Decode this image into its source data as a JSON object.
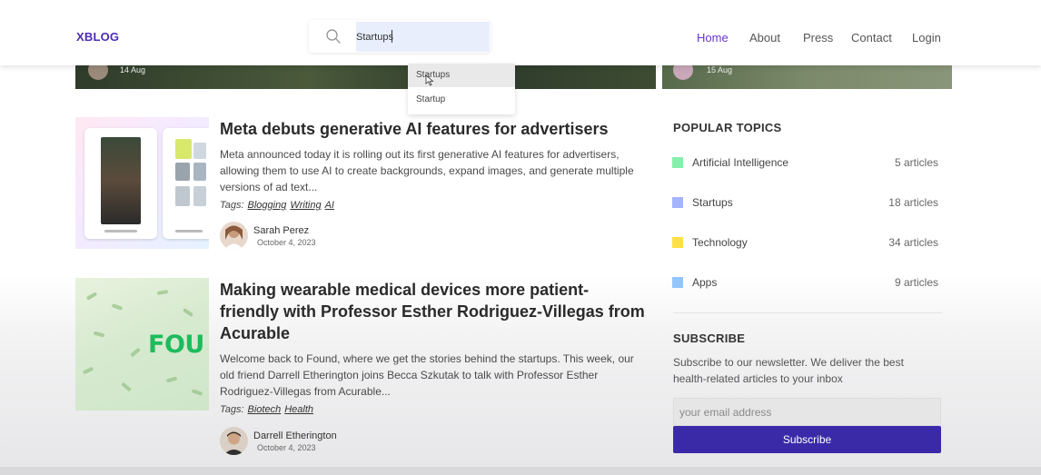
{
  "header": {
    "logo": "XBLOG",
    "search": {
      "value": "Startups",
      "placeholder": ""
    },
    "nav": [
      {
        "label": "Home",
        "active": true
      },
      {
        "label": "About"
      },
      {
        "label": "Press"
      },
      {
        "label": "Contact"
      },
      {
        "label": "Login"
      }
    ]
  },
  "autocomplete": [
    "Startups",
    "Startup"
  ],
  "hero_strips": [
    {
      "date": "14 Aug"
    },
    {
      "date": "15 Aug"
    }
  ],
  "articles": [
    {
      "title": "Meta debuts generative AI features for advertisers",
      "excerpt": "Meta announced today it is rolling out its first generative AI features for advertisers, allowing them to use AI to create backgrounds, expand images, and generate multiple versions of ad text...",
      "tags_label": "Tags:",
      "tags": [
        "Blogging",
        "Writing",
        "AI"
      ],
      "author": "Sarah Perez",
      "date": "October 4, 2023"
    },
    {
      "title": "Making wearable medical devices more patient-friendly with Professor Esther Rodriguez-Villegas from Acurable",
      "thumb_text": "FOU",
      "excerpt": "Welcome back to Found, where we get the stories behind the startups. This week, our old friend Darrell Etherington joins Becca Szkutak to talk with Professor Esther Rodriguez-Villegas from Acurable...",
      "tags_label": "Tags:",
      "tags": [
        "Biotech",
        "Health"
      ],
      "author": "Darrell Etherington",
      "date": "October 4, 2023"
    }
  ],
  "sidebar": {
    "popular_heading": "POPULAR TOPICS",
    "topics": [
      {
        "label": "Artificial Intelligence",
        "count": "5 articles",
        "color": "#86efac"
      },
      {
        "label": "Startups",
        "count": "18 articles",
        "color": "#a5b4fc"
      },
      {
        "label": "Technology",
        "count": "34 articles",
        "color": "#fde047"
      },
      {
        "label": "Apps",
        "count": "9 articles",
        "color": "#93c5fd"
      }
    ],
    "subscribe_heading": "SUBSCRIBE",
    "subscribe_text": "Subscribe to our newsletter. We deliver the best health-related articles to your inbox",
    "email_placeholder": "your email address",
    "subscribe_button": "Subscribe"
  }
}
